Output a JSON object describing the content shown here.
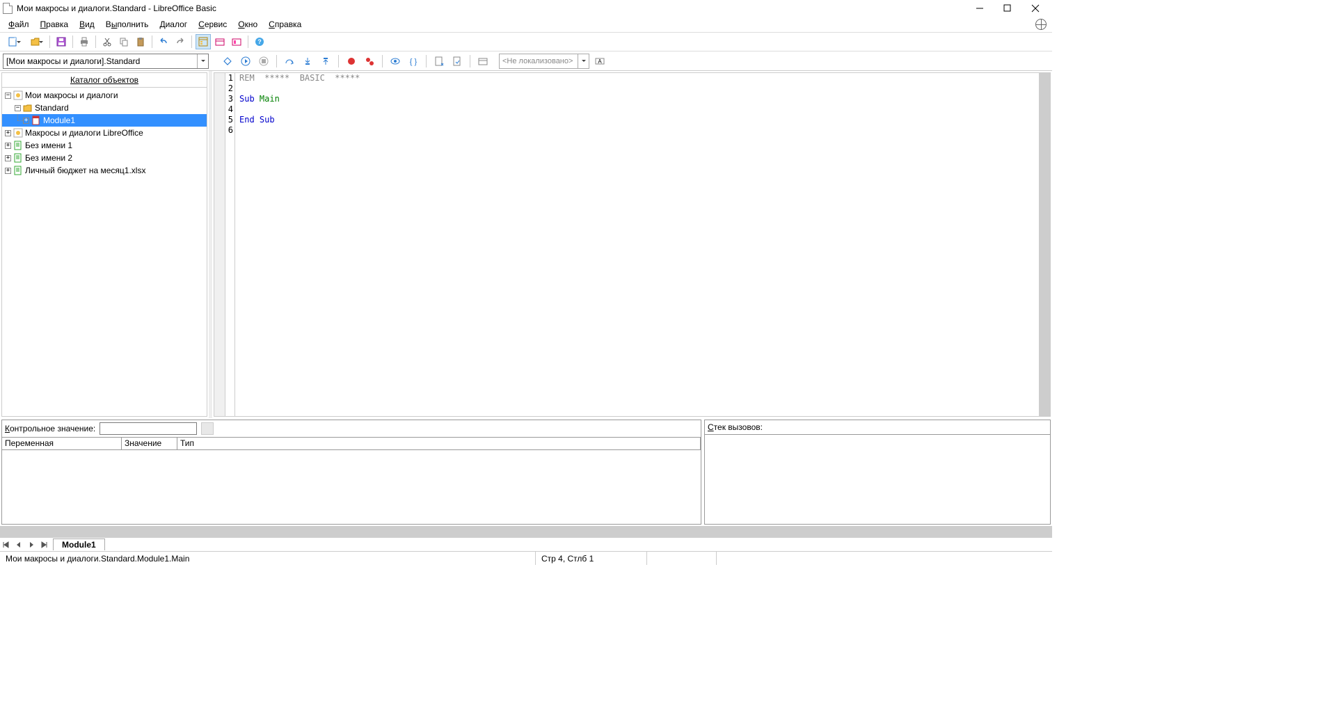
{
  "window": {
    "title": "Мои макросы и диалоги.Standard - LibreOffice Basic"
  },
  "menu": [
    "Файл",
    "Правка",
    "Вид",
    "Выполнить",
    "Диалог",
    "Сервис",
    "Окно",
    "Справка"
  ],
  "menu_accel": [
    "Ф",
    "П",
    "В",
    "ы",
    "Д",
    "С",
    "О",
    "С"
  ],
  "library_combo": "[Мои макросы и диалоги].Standard",
  "locale_combo": "<Не локализовано>",
  "catalog": {
    "title": "Каталог объектов",
    "accel_char": "К",
    "roots": [
      {
        "label": "Мои макросы и диалоги",
        "expanded": true,
        "icon": "lib",
        "children": [
          {
            "label": "Standard",
            "expanded": true,
            "icon": "folder",
            "children": [
              {
                "label": "Module1",
                "icon": "module",
                "selected": true
              }
            ]
          }
        ]
      },
      {
        "label": "Макросы и диалоги LibreOffice",
        "icon": "lib",
        "expanded": false
      },
      {
        "label": "Без имени 1",
        "icon": "doc",
        "expanded": false
      },
      {
        "label": "Без имени 2",
        "icon": "doc",
        "expanded": false
      },
      {
        "label": "Личный бюджет на месяц1.xlsx",
        "icon": "doc",
        "expanded": false
      }
    ]
  },
  "code": {
    "gutter": [
      "1",
      "2",
      "3",
      "4",
      "5",
      "6"
    ],
    "lines": [
      [
        {
          "t": "REM  *****  BASIC  *****",
          "c": "comment"
        }
      ],
      [],
      [
        {
          "t": "Sub ",
          "c": "keyword"
        },
        {
          "t": "Main",
          "c": "ident"
        }
      ],
      [],
      [
        {
          "t": "End Sub",
          "c": "keyword"
        }
      ],
      []
    ]
  },
  "watch": {
    "label": "Контрольное значение:",
    "accel_char": "К",
    "columns": [
      "Переменная",
      "Значение",
      "Тип"
    ]
  },
  "callstack": {
    "label": "Стек вызовов:",
    "accel_char": "С"
  },
  "module_tab": "Module1",
  "status": {
    "path": "Мои макросы и диалоги.Standard.Module1.Main",
    "pos": "Стр 4, Стлб 1"
  }
}
